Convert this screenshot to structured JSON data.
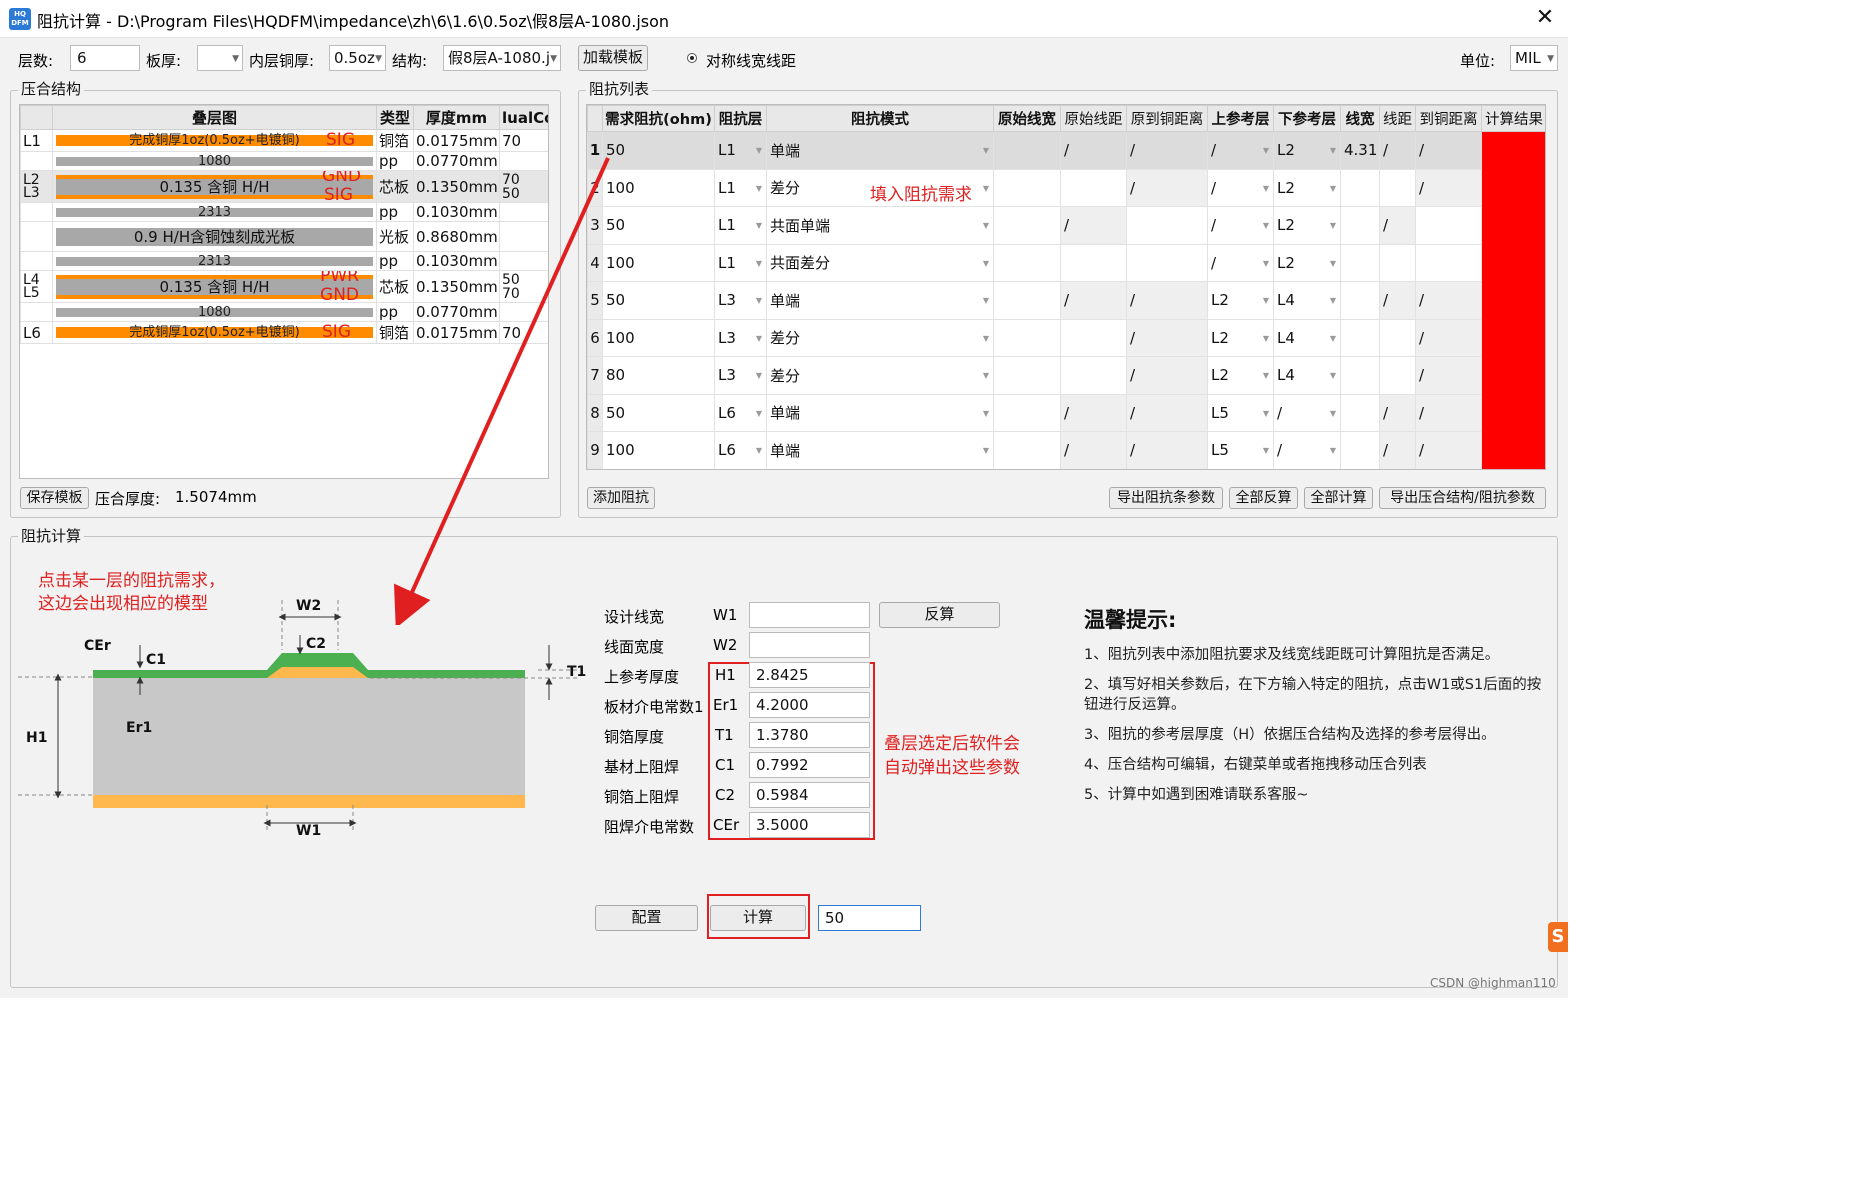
{
  "window": {
    "icon_text": "HQ DFM",
    "title": "阻抗计算 - D:\\Program Files\\HQDFM\\impedance\\zh\\6\\1.6\\0.5oz\\假8层A-1080.json",
    "close": "✕"
  },
  "toolbar": {
    "layers_label": "层数:",
    "layers_value": "6",
    "thickness_label": "板厚:",
    "thickness_value": "",
    "inner_cu_label": "内层铜厚:",
    "inner_cu_value": "0.5oz",
    "structure_label": "结构:",
    "structure_value": "假8层A-1080.j",
    "load_template": "加载模板",
    "symmetric_label": "对称线宽线距",
    "unit_label": "单位:",
    "unit_value": "MIL"
  },
  "stack": {
    "title": "压合结构",
    "headers": [
      "叠层图",
      "类型",
      "厚度mm",
      "lualCo"
    ],
    "rows": [
      {
        "layer": "L1",
        "bar": "完成铜厚1oz(0.5oz+电镀铜)",
        "tag": "SIG",
        "type": "铜箔",
        "thick": "0.0175mm",
        "dual": "70"
      },
      {
        "layer": "",
        "bar": "1080",
        "tag": "",
        "type": "pp",
        "thick": "0.0770mm",
        "dual": ""
      },
      {
        "layer": "L2\nL3",
        "bar": "0.135 含铜 H/H",
        "tag": "GND",
        "tag2": "SIG",
        "type": "芯板",
        "thick": "0.1350mm",
        "dual": "70",
        "dual2": "50"
      },
      {
        "layer": "",
        "bar": "2313",
        "tag": "",
        "type": "pp",
        "thick": "0.1030mm",
        "dual": ""
      },
      {
        "layer": "",
        "bar": "0.9 H/H含铜蚀刻成光板",
        "tag": "",
        "type": "光板",
        "thick": "0.8680mm",
        "dual": ""
      },
      {
        "layer": "",
        "bar": "2313",
        "tag": "",
        "type": "pp",
        "thick": "0.1030mm",
        "dual": ""
      },
      {
        "layer": "L4\nL5",
        "bar": "0.135 含铜 H/H",
        "tag": "PWR",
        "tag2": "GND",
        "type": "芯板",
        "thick": "0.1350mm",
        "dual": "50",
        "dual2": "70"
      },
      {
        "layer": "",
        "bar": "1080",
        "tag": "",
        "type": "pp",
        "thick": "0.0770mm",
        "dual": ""
      },
      {
        "layer": "L6",
        "bar": "完成铜厚1oz(0.5oz+电镀铜)",
        "tag": "SIG",
        "type": "铜箔",
        "thick": "0.0175mm",
        "dual": "70"
      }
    ],
    "save_template": "保存模板",
    "total_label": "压合厚度:",
    "total_value": "1.5074mm"
  },
  "impedance": {
    "title": "阻抗列表",
    "headers": [
      "需求阻抗(ohm)",
      "阻抗层",
      "阻抗模式",
      "原始线宽",
      "原始线距",
      "原到铜距离",
      "上参考层",
      "下参考层",
      "线宽",
      "线距",
      "到铜距离",
      "计算结果"
    ],
    "rows": [
      {
        "n": "1",
        "ohm": "50",
        "layer": "L1",
        "mode": "单端",
        "ow": "",
        "os": "/",
        "oc": "/",
        "up": "/",
        "down": "L2",
        "w": "4.31",
        "s": "/",
        "c": "/"
      },
      {
        "n": "2",
        "ohm": "100",
        "layer": "L1",
        "mode": "差分",
        "ow": "",
        "os": "",
        "oc": "/",
        "up": "/",
        "down": "L2",
        "w": "",
        "s": "",
        "c": "/"
      },
      {
        "n": "3",
        "ohm": "50",
        "layer": "L1",
        "mode": "共面单端",
        "ow": "",
        "os": "/",
        "oc": "",
        "up": "/",
        "down": "L2",
        "w": "",
        "s": "/",
        "c": ""
      },
      {
        "n": "4",
        "ohm": "100",
        "layer": "L1",
        "mode": "共面差分",
        "ow": "",
        "os": "",
        "oc": "",
        "up": "/",
        "down": "L2",
        "w": "",
        "s": "",
        "c": ""
      },
      {
        "n": "5",
        "ohm": "50",
        "layer": "L3",
        "mode": "单端",
        "ow": "",
        "os": "/",
        "oc": "/",
        "up": "L2",
        "down": "L4",
        "w": "",
        "s": "/",
        "c": "/"
      },
      {
        "n": "6",
        "ohm": "100",
        "layer": "L3",
        "mode": "差分",
        "ow": "",
        "os": "",
        "oc": "/",
        "up": "L2",
        "down": "L4",
        "w": "",
        "s": "",
        "c": "/"
      },
      {
        "n": "7",
        "ohm": "80",
        "layer": "L3",
        "mode": "差分",
        "ow": "",
        "os": "",
        "oc": "/",
        "up": "L2",
        "down": "L4",
        "w": "",
        "s": "",
        "c": "/"
      },
      {
        "n": "8",
        "ohm": "50",
        "layer": "L6",
        "mode": "单端",
        "ow": "",
        "os": "/",
        "oc": "/",
        "up": "L5",
        "down": "/",
        "w": "",
        "s": "/",
        "c": "/"
      },
      {
        "n": "9",
        "ohm": "100",
        "layer": "L6",
        "mode": "单端",
        "ow": "",
        "os": "/",
        "oc": "/",
        "up": "L5",
        "down": "/",
        "w": "",
        "s": "/",
        "c": "/"
      }
    ],
    "add": "添加阻抗",
    "export_bars": "导出阻抗条参数",
    "reverse_all": "全部反算",
    "calc_all": "全部计算",
    "export_struct": "导出压合结构/阻抗参数",
    "annotation": "填入阻抗需求"
  },
  "calc": {
    "title": "阻抗计算",
    "annotation_model": "点击某一层的阻抗需求，\n这边会出现相应的模型",
    "annotation_params": "叠层选定后软件会\n自动弹出这些参数",
    "diagram": {
      "w2": "W2",
      "c2": "C2",
      "cer": "CEr",
      "c1": "C1",
      "t1": "T1",
      "h1": "H1",
      "er1": "Er1",
      "w1": "W1"
    },
    "params": [
      {
        "label": "设计线宽",
        "sym": "W1",
        "value": ""
      },
      {
        "label": "线面宽度",
        "sym": "W2",
        "value": ""
      },
      {
        "label": "上参考厚度",
        "sym": "H1",
        "value": "2.8425"
      },
      {
        "label": "板材介电常数1",
        "sym": "Er1",
        "value": "4.2000"
      },
      {
        "label": "铜箔厚度",
        "sym": "T1",
        "value": "1.3780"
      },
      {
        "label": "基材上阻焊",
        "sym": "C1",
        "value": "0.7992"
      },
      {
        "label": "铜箔上阻焊",
        "sym": "C2",
        "value": "0.5984"
      },
      {
        "label": "阻焊介电常数",
        "sym": "CEr",
        "value": "3.5000"
      }
    ],
    "reverse_btn": "反算",
    "config_btn": "配置",
    "calc_btn": "计算",
    "result_value": "50",
    "tips_title": "温馨提示:",
    "tips": [
      "1、阻抗列表中添加阻抗要求及线宽线距既可计算阻抗是否满足。",
      "2、填写好相关参数后，在下方输入特定的阻抗，点击W1或S1后面的按钮进行反运算。",
      "3、阻抗的参考层厚度（H）依据压合结构及选择的参考层得出。",
      "4、压合结构可编辑，右键菜单或者拖拽移动压合列表",
      "5、计算中如遇到困难请联系客服~"
    ]
  },
  "watermark": "CSDN @highman110",
  "colors": {
    "copper": "#ff8c00",
    "dielectric": "#a8a8a8",
    "result_red": "#ff0000",
    "annotation_red": "#e02020",
    "mask_green": "#4caf50",
    "trace_orange": "#ffb84d"
  }
}
